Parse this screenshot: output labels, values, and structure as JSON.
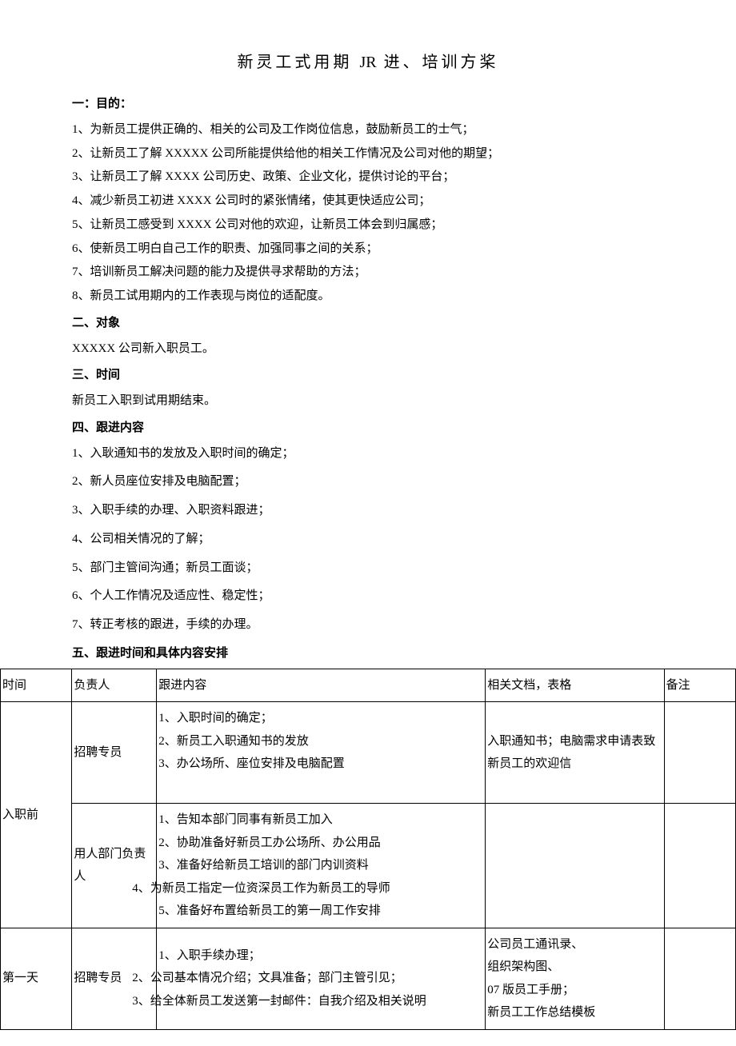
{
  "title_a": "新灵工式用期",
  "title_latin": "JR",
  "title_b": "进、培训方桨",
  "s1": {
    "head": "一：目的：",
    "items": [
      "1、为新员工提供正确的、相关的公司及工作岗位信息，鼓励新员工的士气；",
      "2、让新员工了解 XXXXX 公司所能提供给他的相关工作情况及公司对他的期望；",
      "3、让新员工了解 XXXX 公司历史、政策、企业文化，提供讨论的平台；",
      "4、减少新员工初进 XXXX 公司时的紧张情绪，使其更快适应公司；",
      "5、让新员工感受到 XXXX 公司对他的欢迎，让新员工体会到归属感；",
      "6、使新员工明白自己工作的职责、加强同事之间的关系；",
      "7、培训新员工解决问题的能力及提供寻求帮助的方法；",
      "8、新员工试用期内的工作表现与岗位的适配度。"
    ]
  },
  "s2": {
    "head": "二、对象",
    "body": "XXXXX 公司新入职员工。"
  },
  "s3": {
    "head": "三、时间",
    "body": "新员工入职到试用期结束。"
  },
  "s4": {
    "head": "四、跟进内容",
    "items": [
      "1、入耿通知书的发放及入职时间的确定；",
      "2、新人员座位安排及电脑配置；",
      "3、入职手续的办理、入职资料跟进；",
      "4、公司相关情况的了解；",
      "5、部门主管间沟通；新员工面谈；",
      "6、个人工作情况及适应性、稳定性；",
      "7、转正考核的跟进，手续的办理。"
    ]
  },
  "s5": {
    "head": "五、跟进时间和具体内容安排"
  },
  "table": {
    "header": {
      "time": "时间",
      "resp": "负责人",
      "content": "跟进内容",
      "docs": "相关文档，表格",
      "note": "备注"
    },
    "group1": {
      "time": "入职前",
      "row1": {
        "resp": "招聘专员",
        "content": [
          "1、入职时间的确定；",
          "2、新员工入职通知书的发放",
          "3、办公场所、座位安排及电脑配置"
        ],
        "docs": "入职通知书；电脑需求申请表致新员工的欢迎信"
      },
      "row2": {
        "resp": "用人部门负责人",
        "content": [
          "1、告知本部门同事有新员工加入",
          "2、协助准备好新员工办公场所、办公用品",
          "3、准备好给新员工培训的部门内训资料",
          "4、为新员工指定一位资深员工作为新员工的导师",
          "5、准备好布置给新员工的第一周工作安排"
        ],
        "docs": ""
      }
    },
    "group2": {
      "time": "第一天",
      "resp": "招聘专员",
      "content": [
        "1、入职手续办理；",
        "2、公司基本情况介绍；文具准备；部门主管引见；",
        "3、给全体新员工发送第一封邮件：自我介绍及相关说明"
      ],
      "docs_lines": [
        "公司员工通讯录、",
        "组织架构图、",
        "07 版员工手册；",
        "新员工工作总结模板"
      ]
    }
  }
}
